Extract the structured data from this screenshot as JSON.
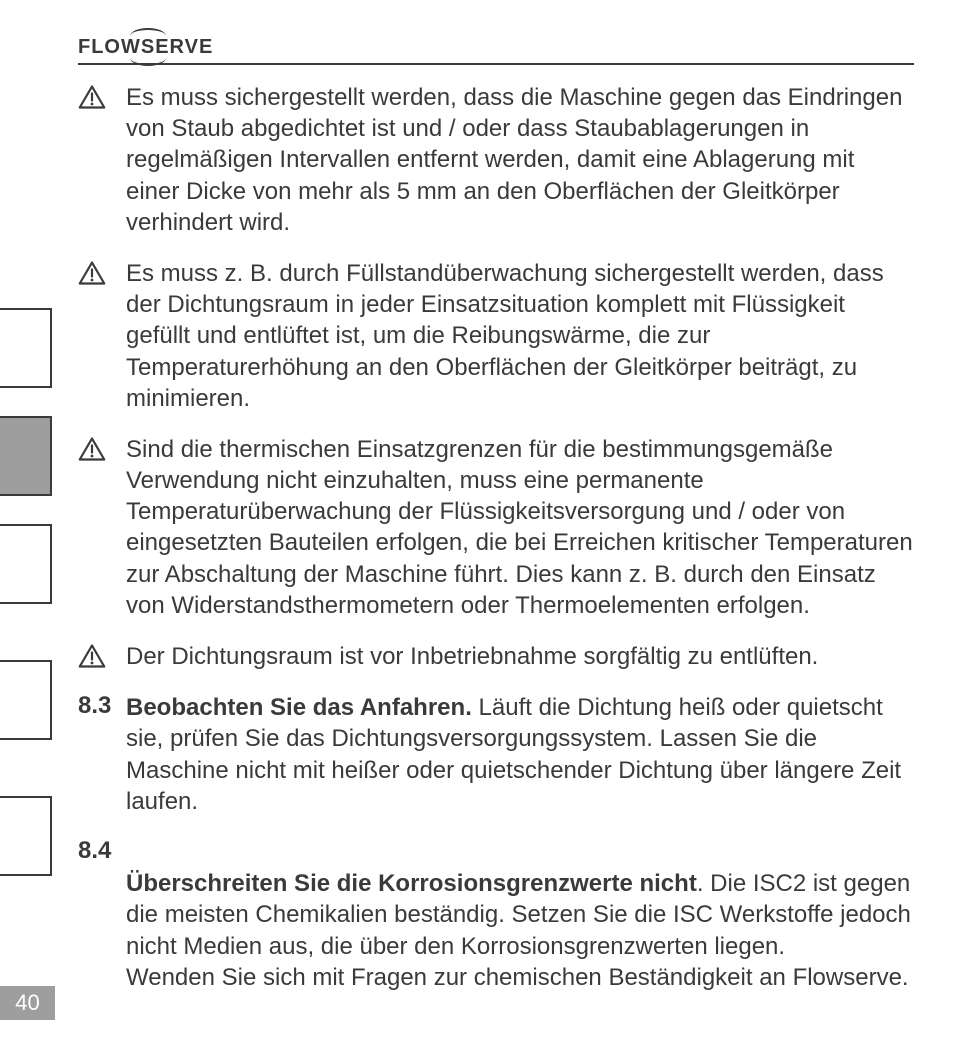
{
  "logo": "FLOWSERVE",
  "page_number": "40",
  "warnings": [
    "Es muss sichergestellt werden, dass die Maschine gegen das Eindringen von Staub abgedichtet ist und / oder dass Staubab­lagerungen in regelmäßigen Intervallen entfernt werden, damit eine Ablagerung mit einer Dicke von mehr als 5 mm an den Oberflächen der Gleitkörper verhindert wird.",
    "Es muss z. B. durch Füllstandüberwachung sichergestellt werden, dass der Dichtungsraum in jeder Einsatzsituation komplett mit Flüssigkeit gefüllt und entlüftet ist, um die Reibungswärme, die zur Temperaturerhöhung an den Oberflächen der Gleitkörper bei­trägt, zu minimieren.",
    "Sind die thermischen Einsatzgrenzen für die bestimmungsge­mäße Verwendung nicht einzuhalten, muss eine permanente Temperaturüberwachung der Flüssigkeitsversorgung und / oder von eingesetzten Bauteilen erfolgen, die bei Erreichen kritischer Temperaturen zur Abschaltung der Maschine führt. Dies kann z. B. durch den Einsatz von Widerstandsthermometern oder Thermoelementen erfolgen.",
    "Der Dichtungsraum ist vor Inbetriebnahme sorgfältig zu entlüften."
  ],
  "sections": [
    {
      "num": "8.3",
      "bold": "Beobachten Sie das Anfahren.",
      "text": " Läuft die Dichtung heiß oder quietscht sie, prüfen Sie das Dichtungsversorgungssystem. Lassen Sie die Maschine nicht mit heißer oder quietschender Dichtung über längere Zeit laufen."
    },
    {
      "num": "8.4",
      "bold": "Überschreiten Sie die Korrosionsgrenzwerte nicht",
      "text": ". Die ISC2 ist gegen die meisten Chemikalien beständig. Setzen Sie die ISC Werkstoffe jedoch nicht Medien aus, die über den Korrosionsgrenzwerten liegen.\nWenden Sie sich mit Fragen zur chemischen Beständigkeit an Flowserve."
    }
  ]
}
